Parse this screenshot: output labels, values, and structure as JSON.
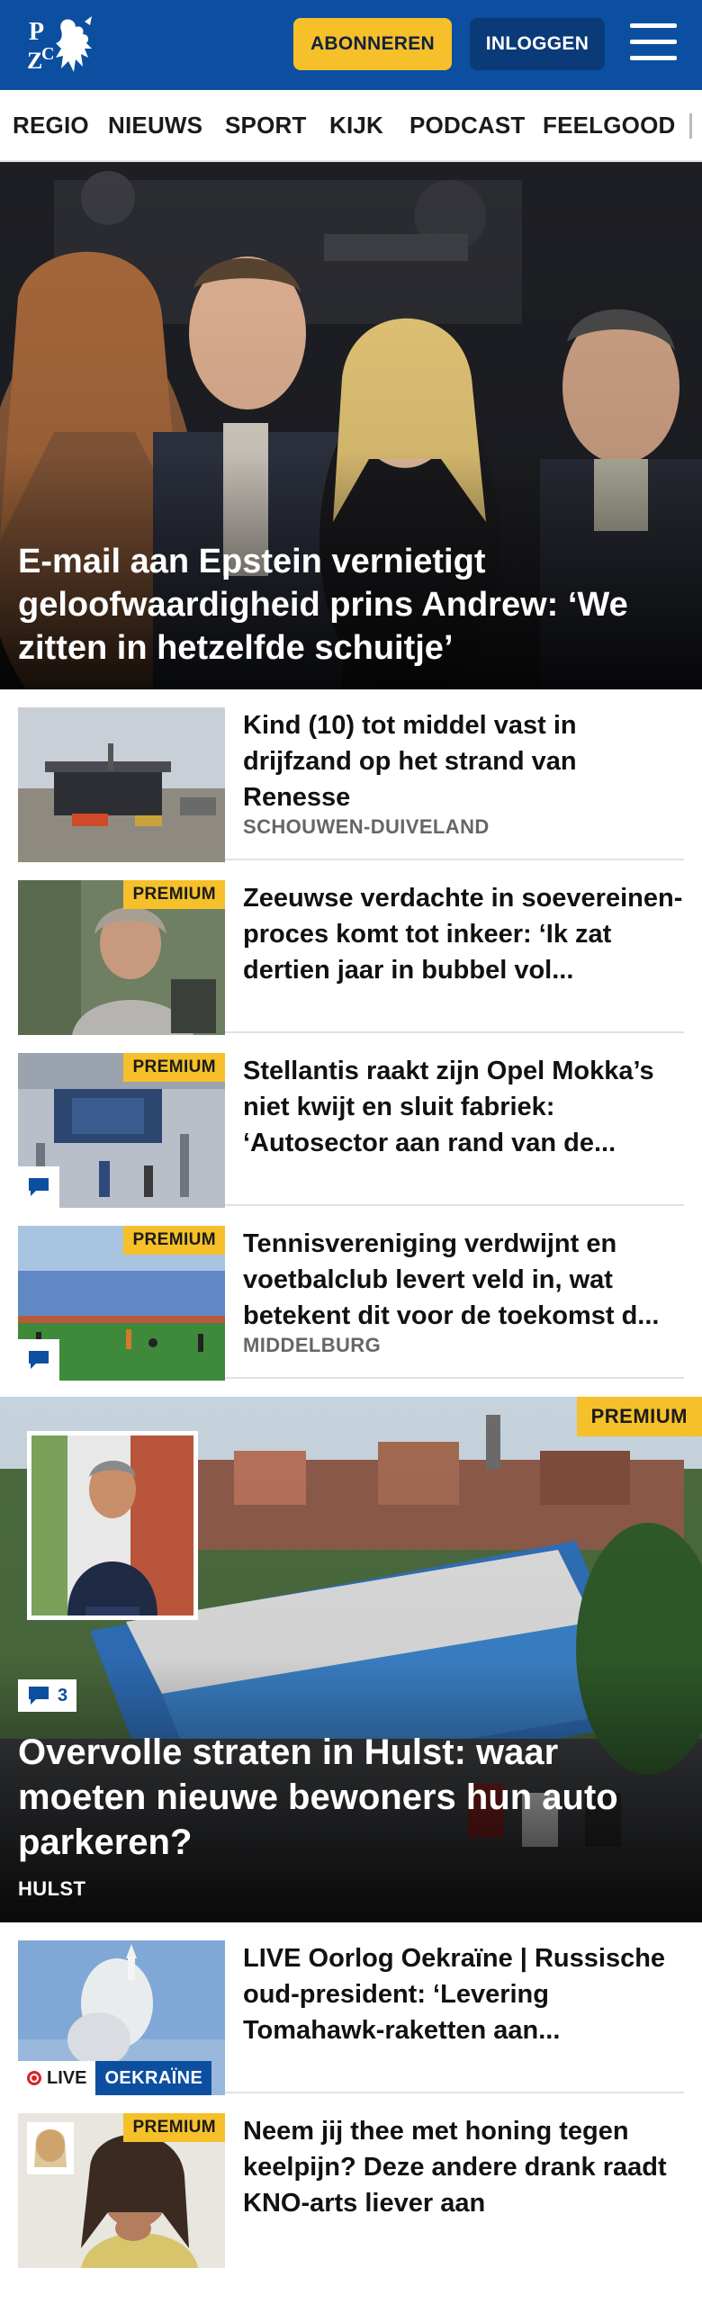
{
  "header": {
    "logo_text": "PZC",
    "subscribe_label": "ABONNEREN",
    "login_label": "INLOGGEN",
    "menu_icon": "hamburger-menu-icon",
    "brand_color": "#0c4fa0",
    "accent_color": "#f5c02a"
  },
  "nav": {
    "items": [
      "REGIO",
      "NIEUWS",
      "SPORT",
      "KIJK",
      "PODCAST",
      "FEELGOOD"
    ]
  },
  "hero": {
    "headline": "E-mail aan Epstein vernietigt geloofwaardigheid prins Andrew: ‘We zitten in hetzelfde schuitje’"
  },
  "articles": [
    {
      "title": "Kind (10) tot middel vast in drijfzand op het strand van Renesse",
      "tag": "SCHOUWEN-DUIVELAND"
    },
    {
      "title": "Zeeuwse verdachte in soeverei­nen-proces komt tot inkeer: ‘Ik zat dertien jaar in bubbel vol...",
      "premium": "PREMIUM"
    },
    {
      "title": "Stellantis raakt zijn Opel Mokka’s niet kwijt en sluit fabriek: ‘Autosector aan rand van de...",
      "premium": "PREMIUM",
      "comment_icon": "comment-icon"
    },
    {
      "title": "Tennisvereniging verdwijnt en voetbalclub levert veld in, wat betekent dit voor de toekomst d...",
      "tag": "MIDDELBURG",
      "premium": "PREMIUM",
      "comment_icon": "comment-icon"
    }
  ],
  "feature": {
    "premium": "PREMIUM",
    "comment_count": "3",
    "headline": "Overvolle straten in Hulst: waar moeten nieuwe bewoners hun auto parkeren?",
    "tag": "HULST"
  },
  "articles2": [
    {
      "title": "LIVE Oorlog Oekraïne | Russische oud-president: ‘Levering Tomahawk-raketten aan...",
      "live_label": "LIVE",
      "topic": "OEKRAÏNE"
    },
    {
      "title": "Neem jij thee met honing tegen keelpijn? Deze andere drank raadt KNO-arts liever aan",
      "premium": "PREMIUM"
    }
  ]
}
